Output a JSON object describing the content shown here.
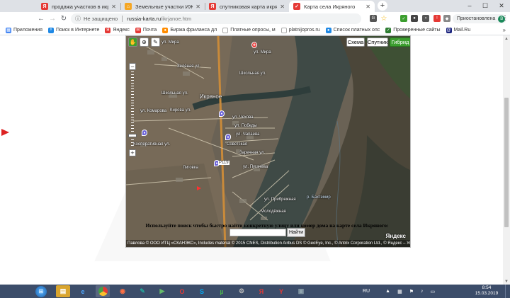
{
  "browser": {
    "tabs": [
      {
        "title": "продажа участков в икряном -",
        "icon": "yandex-icon",
        "color": "#e53935",
        "active": false
      },
      {
        "title": "Земельные участки ИЖС в Икр",
        "icon": "house-icon",
        "color": "#f5a623",
        "active": false
      },
      {
        "title": "спутниковая карта икряное —",
        "icon": "yandex-icon",
        "color": "#e53935",
        "active": false
      },
      {
        "title": "Карта села Икряного",
        "icon": "bookmark-icon",
        "color": "#e53935",
        "active": true
      }
    ],
    "new_tab": "+",
    "window": {
      "minimize": "–",
      "maximize": "☐",
      "close": "✕"
    },
    "nav": {
      "back": "←",
      "forward": "→",
      "reload": "C"
    },
    "url": {
      "security": "Не защищено",
      "domain": "russia-karta.ru",
      "path": "/ikrjanoe.htm"
    },
    "profile": {
      "label": "Приостановлена",
      "initial": "В"
    },
    "menu": "⋮"
  },
  "bookmarks": [
    {
      "label": "Приложения",
      "color": "#4285f4"
    },
    {
      "label": "Поиск в Интернете",
      "color": "#1e88e5"
    },
    {
      "label": "Яндекс",
      "color": "#e53935"
    },
    {
      "label": "Почта",
      "color": "#e53935"
    },
    {
      "label": "Биржа фриланса дл",
      "color": "#ff8c00"
    },
    {
      "label": "Платные опросы, м",
      "color": "#777777"
    },
    {
      "label": "platnijopros.ru",
      "color": "#777777"
    },
    {
      "label": "Список платных опс",
      "color": "#1e88e5"
    },
    {
      "label": "Проверенные сайты",
      "color": "#2e7d32"
    },
    {
      "label": "Mail.Ru",
      "color": "#1a237e"
    }
  ],
  "map": {
    "type_buttons": [
      {
        "label": "Схема",
        "active": false
      },
      {
        "label": "Спутник",
        "active": false
      },
      {
        "label": "Гибрид",
        "active": true
      }
    ],
    "zoom_in": "+",
    "zoom_out": "−",
    "labels": [
      "ул. Мира",
      "Зелёная ул.",
      "ул. Мира",
      "Школьная ул.",
      "Школьная ул.",
      "Икряное",
      "Кирова ул.",
      "ул. Комарова",
      "ул. Чехова",
      "ул. Победы",
      "ул. Чапаева",
      "Советская",
      "Кооперативная ул.",
      "Заречная ул.",
      "ул. Пугачёва",
      "Лиговка",
      "ул. Прибрежная",
      "р. Бахтемир",
      "Молодёжная",
      "Р119"
    ],
    "copyright": "Павлова © ООО ИТЦ «СКАНЭКС», Includes material © 2015 CNES, Distribution Airbus DS © GeoEye, Inc., © Antrix Corporation Ltd., © Яндекс – Условия использования",
    "logo": "Яндекс"
  },
  "search": {
    "text": "Используйте поиск чтобы быстро найти конкретную улицу или номер дома на карте села Икряного:",
    "input_value": "",
    "button": "Найти"
  },
  "taskbar": {
    "apps": [
      {
        "icon": "explorer-icon",
        "color": "#f0c040"
      },
      {
        "icon": "ie-icon",
        "color": "#1e88e5"
      },
      {
        "icon": "chrome-icon",
        "color": "#4caf50"
      },
      {
        "icon": "firefox-icon",
        "color": "#ff7043"
      },
      {
        "icon": "notepad-icon",
        "color": "#26a69a"
      },
      {
        "icon": "media-icon",
        "color": "#43a047"
      },
      {
        "icon": "opera-icon",
        "color": "#e53935"
      },
      {
        "icon": "skype-icon",
        "color": "#03a9f4"
      },
      {
        "icon": "utorrent-icon",
        "color": "#4caf50"
      },
      {
        "icon": "settings-icon",
        "color": "#9e9e9e"
      },
      {
        "icon": "yandex-icon",
        "color": "#e53935"
      },
      {
        "icon": "yandex-browser-icon",
        "color": "#e53935"
      },
      {
        "icon": "photos-icon",
        "color": "#607d8b"
      }
    ],
    "lang": "RU",
    "time": "8:54",
    "date": "15.03.2019"
  }
}
